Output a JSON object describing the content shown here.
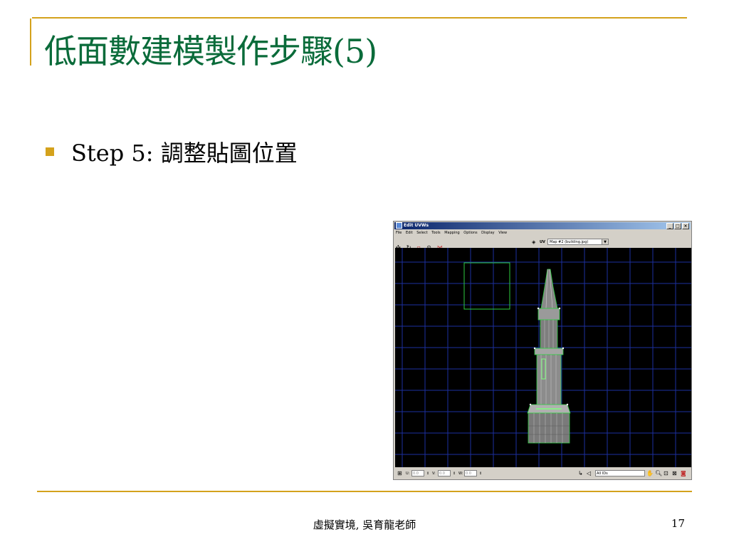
{
  "slide": {
    "title": "低面數建模製作步驟(5)",
    "bullet": "Step 5: 調整貼圖位置",
    "footer": "虛擬實境, 吳育龍老師",
    "page_number": "17"
  },
  "colors": {
    "accent_gold": "#d4a21c",
    "title_green": "#0a6b3a",
    "viewport_bg": "#000000",
    "grid_blue": "#1c2fa0",
    "uv_green": "#2ecc40"
  },
  "uv_window": {
    "title": "Edit UVWs",
    "window_buttons": [
      "_",
      "□",
      "×"
    ],
    "menu": [
      "File",
      "Edit",
      "Select",
      "Tools",
      "Mapping",
      "Options",
      "Display",
      "View"
    ],
    "toolbar_icons": [
      "move-icon",
      "rotate-icon",
      "scale-icon",
      "freeform-icon",
      "mirror-icon"
    ],
    "uvw_label": "UV",
    "map_select": "Map #2 (building.jpg)",
    "status": {
      "u_label": "U:",
      "v_label": "V:",
      "w_label": "W:",
      "u_value": "0.0",
      "v_value": "0.0",
      "w_value": "0.0",
      "id_filter": "All IDs"
    }
  }
}
